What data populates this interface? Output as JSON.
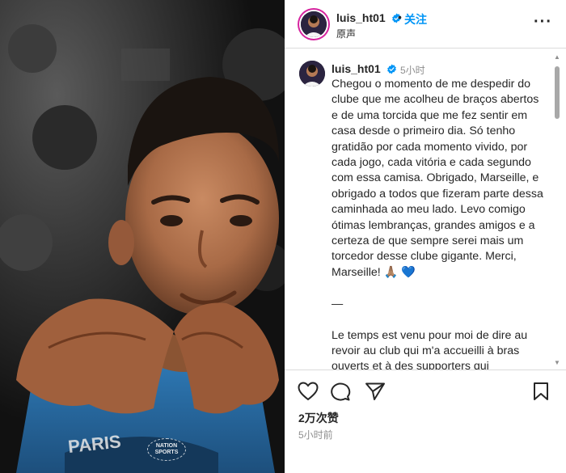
{
  "post": {
    "username": "luis_ht01",
    "follow_label": "关注",
    "separator": "•",
    "audio_label": "原声",
    "more_label": "···"
  },
  "caption": {
    "username": "luis_ht01",
    "time": "5小时",
    "text": "Chegou o momento de me despedir do clube que me acolheu de braços abertos e de uma torcida que me fez sentir em casa desde o primeiro dia. Só tenho gratidão por cada momento vivido, por cada jogo, cada vitória e cada segundo com essa camisa. Obrigado, Marseille, e obrigado a todos que fizeram parte dessa caminhada ao meu lado. Levo comigo ótimas lembranças, grandes amigos e a certeza de que sempre serei mais um torcedor desse clube gigante. Merci, Marseille! 🙏🏽 💙\n\n—\n\nLe temps est venu pour moi de dire au revoir au club qui m'a accueilli à bras ouverts et à des supporters qui"
  },
  "stats": {
    "likes": "2万次赞",
    "posted": "5小时前"
  },
  "media": {
    "watermark_line1": "NATION",
    "watermark_line2": "SPORTS"
  },
  "icons": {
    "verified": "verified-badge-icon",
    "like": "heart-icon",
    "comment": "comment-bubble-icon",
    "share": "paper-plane-icon",
    "save": "bookmark-icon"
  },
  "colors": {
    "follow": "#0095f6",
    "verified": "#0095f6",
    "muted": "#8e8e8e",
    "jersey": "#2a6fa8"
  }
}
